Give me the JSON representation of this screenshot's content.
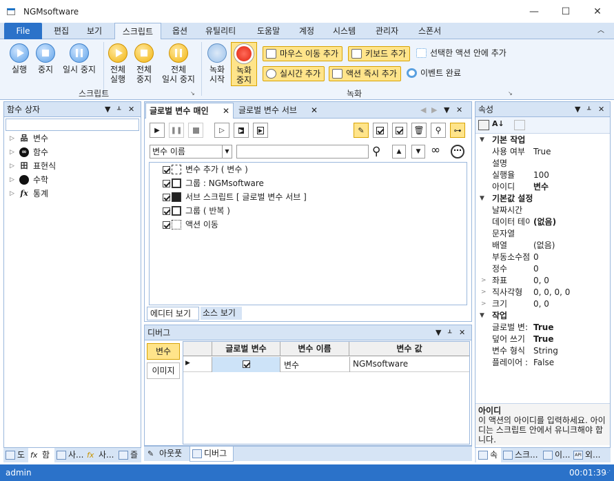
{
  "window": {
    "title": "NGMsoftware",
    "min": "—",
    "max": "☐",
    "close": "✕"
  },
  "menu": [
    "File",
    "편집",
    "보기",
    "스크립트",
    "옵션",
    "유틸리티",
    "도움말",
    "계정",
    "시스템",
    "관리자",
    "스폰서"
  ],
  "ribbon": {
    "script_group": "스크립트",
    "record_group": "녹화",
    "run": "실행",
    "stop": "중지",
    "pause": "일시 중지",
    "run_all_1": "전체",
    "run_all_2": "실행",
    "stop_all_1": "전체",
    "stop_all_2": "중지",
    "pause_all_1": "전체",
    "pause_all_2": "일시 중지",
    "rec_start_1": "녹화",
    "rec_start_2": "시작",
    "rec_stop_1": "녹화",
    "rec_stop_2": "중지",
    "add_mouse_move": "마우스 이동 추가",
    "add_keyboard": "키보드 추가",
    "add_into_selected": "선택한 액션 안에 추가",
    "add_realtime": "실시간 추가",
    "add_action_now": "액션 즉시 추가",
    "event_done": "이벤트 완료"
  },
  "left_panel": {
    "title": "함수 상자",
    "items": [
      {
        "label": "변수",
        "icon": "variable-icon"
      },
      {
        "label": "함수",
        "icon": "function-icon"
      },
      {
        "label": "표현식",
        "icon": "expression-icon"
      },
      {
        "label": "수학",
        "icon": "math-icon"
      },
      {
        "label": "통계",
        "icon": "statistics-icon"
      }
    ],
    "bottom_tabs": [
      "도",
      "함",
      "사...",
      "사...",
      "즐"
    ]
  },
  "editor": {
    "tab_main": "글로벌 변수 매인",
    "tab_sub": "글로벌 변수 서브",
    "select_value": "변수 이름",
    "actions": [
      "변수 추가 ( 변수 )",
      "그룹 : NGMsoftware",
      "서브 스크립트 [ 글로벌 변수 서브 ]",
      "그룹 ( 반복 )",
      "액션 이동"
    ],
    "view_editor": "에디터 보기",
    "view_source": "소스 보기"
  },
  "debug": {
    "title": "디버그",
    "btn_variables": "변수",
    "btn_images": "이미지",
    "columns": [
      "글로벌 변수",
      "변수 이름",
      "변수 값"
    ],
    "rows": [
      {
        "global": true,
        "name": "변수",
        "value": "NGMsoftware"
      }
    ],
    "bottom_tabs": [
      "아웃풋",
      "디버그"
    ]
  },
  "properties": {
    "title": "속성",
    "categories": [
      {
        "name": "기본 작업",
        "rows": [
          {
            "name": "사용 여부",
            "value": "True"
          },
          {
            "name": "설명",
            "value": ""
          },
          {
            "name": "실행율",
            "value": "100"
          },
          {
            "name": "아이디",
            "value": "변수",
            "bold": true
          }
        ]
      },
      {
        "name": "기본값 설정",
        "rows": [
          {
            "name": "날짜시간",
            "value": ""
          },
          {
            "name": "데이터 테이",
            "value": "(없음)",
            "bold": true
          },
          {
            "name": "문자열",
            "value": ""
          },
          {
            "name": "배열",
            "value": "(없음)"
          },
          {
            "name": "부동소수점",
            "value": "0"
          },
          {
            "name": "정수",
            "value": "0"
          },
          {
            "name": "좌표",
            "value": "0, 0",
            "exp": true
          },
          {
            "name": "직사각형",
            "value": "0, 0, 0, 0",
            "exp": true
          },
          {
            "name": "크기",
            "value": "0, 0",
            "exp": true
          }
        ]
      },
      {
        "name": "작업",
        "rows": [
          {
            "name": "글로벌 변:",
            "value": "True",
            "bold": true
          },
          {
            "name": "덮어 쓰기",
            "value": "True",
            "bold": true
          },
          {
            "name": "변수 형식",
            "value": "String"
          },
          {
            "name": "플레이어 :",
            "value": "False"
          }
        ]
      }
    ],
    "desc_title": "아이디",
    "desc_text": "이 액션의 아이디를 입력하세요. 아이디는 스크립트 안에서 유니크해야 합니다.",
    "bottom_tabs": [
      "속",
      "스크...",
      "이...",
      "외..."
    ]
  },
  "status": {
    "user": "admin",
    "time": "00:01:39"
  }
}
